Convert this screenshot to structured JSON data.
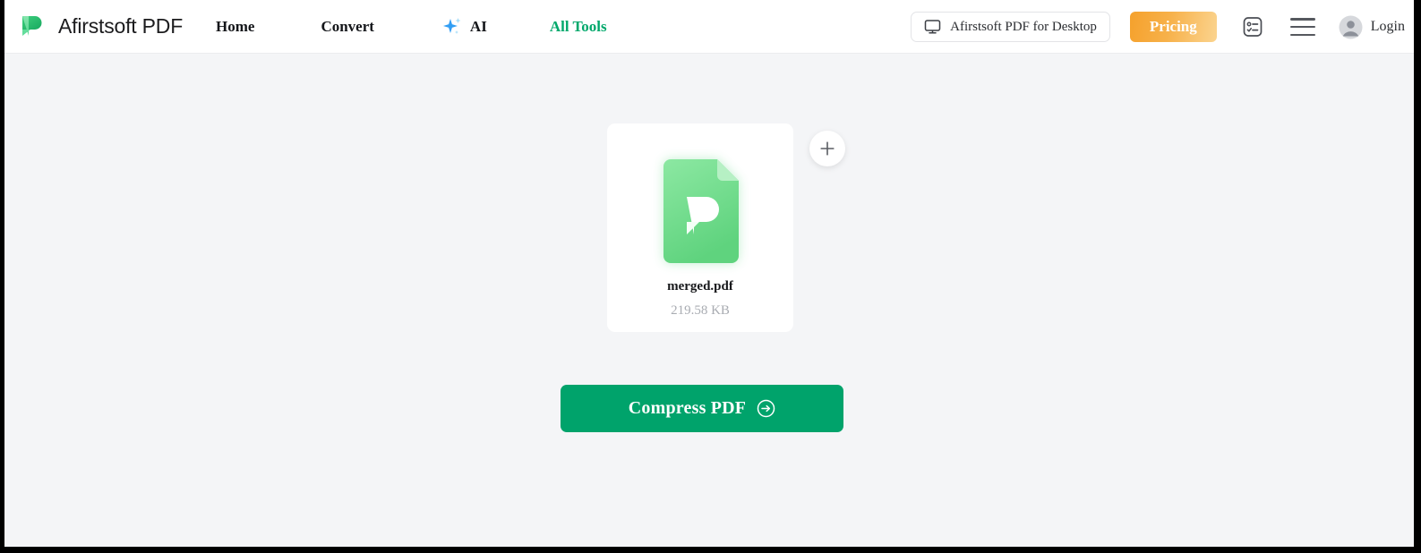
{
  "brand": {
    "name": "Afirstsoft PDF",
    "logo_icon": "afirstsoft-logo-icon"
  },
  "nav": {
    "items": [
      {
        "label": "Home",
        "name": "nav-home"
      },
      {
        "label": "Convert",
        "name": "nav-convert"
      },
      {
        "label": "AI",
        "name": "nav-ai",
        "icon": "sparkle-icon"
      },
      {
        "label": "All Tools",
        "name": "nav-all-tools"
      }
    ]
  },
  "header_right": {
    "desktop_button": {
      "label": "Afirstsoft PDF for Desktop",
      "icon": "monitor-icon"
    },
    "pricing_button": {
      "label": "Pricing"
    },
    "checklist_icon": "checklist-icon",
    "menu_icon": "hamburger-menu-icon",
    "login": {
      "label": "Login",
      "icon": "user-avatar-icon"
    }
  },
  "main": {
    "file": {
      "name": "merged.pdf",
      "size": "219.58 KB",
      "icon": "pdf-file-icon"
    },
    "add_file_button": {
      "icon": "plus-icon"
    },
    "primary_action": {
      "label": "Compress PDF",
      "icon": "arrow-right-circle-icon"
    }
  },
  "colors": {
    "brand_green": "#00a86b",
    "action_green": "#00a36b",
    "pricing_orange_start": "#f5a12c",
    "pricing_orange_end": "#fbd48f",
    "page_background": "#f4f5f7",
    "file_icon_green": "#7ddc92"
  }
}
